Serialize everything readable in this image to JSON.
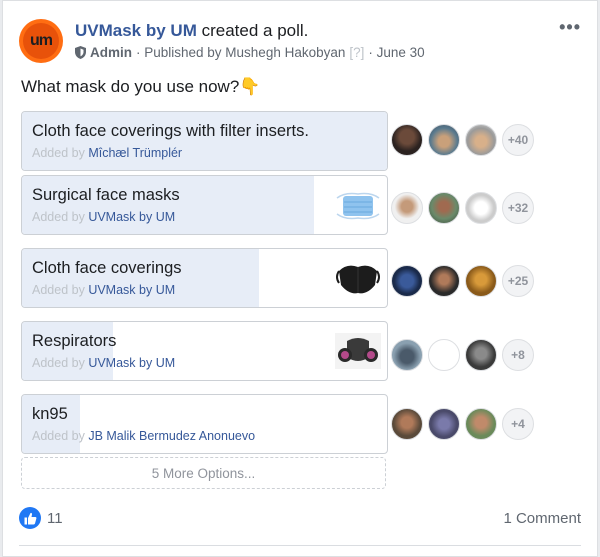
{
  "post": {
    "avatar_text": "um",
    "page_name": "UVMask by UM",
    "action": "created a poll.",
    "role": "Admin",
    "published_by": "· Published by Mushegh Hakobyan",
    "help_mark": "[?]",
    "date": "· June 30",
    "menu_icon": "more-options-icon",
    "question": "What mask do you use now?👇"
  },
  "poll": {
    "options": [
      {
        "label": "Cloth face coverings with filter inserts.",
        "added_prefix": "Added by",
        "added_by": "Mîchæl Trümplér",
        "share": 1.0,
        "count": "+40"
      },
      {
        "label": "Surgical face masks",
        "added_prefix": "Added by",
        "added_by": "UVMask by UM",
        "share": 0.8,
        "count": "+32"
      },
      {
        "label": "Cloth face coverings",
        "added_prefix": "Added by",
        "added_by": "UVMask by UM",
        "share": 0.65,
        "count": "+25"
      },
      {
        "label": "Respirators",
        "added_prefix": "Added by",
        "added_by": "UVMask by UM",
        "share": 0.25,
        "count": "+8"
      },
      {
        "label": "kn95",
        "added_prefix": "Added by",
        "added_by": "JB Malik Bermudez Anonuevo",
        "share": 0.16,
        "count": "+4"
      }
    ],
    "more_options": "5 More Options..."
  },
  "footer": {
    "like_icon": "thumbs-up-icon",
    "like_count": "11",
    "comments": "1 Comment"
  },
  "colors": {
    "brand": "#365899",
    "fill": "#e7edf7",
    "like": "#2078f4",
    "avatar_orange": "#ff6d12"
  }
}
